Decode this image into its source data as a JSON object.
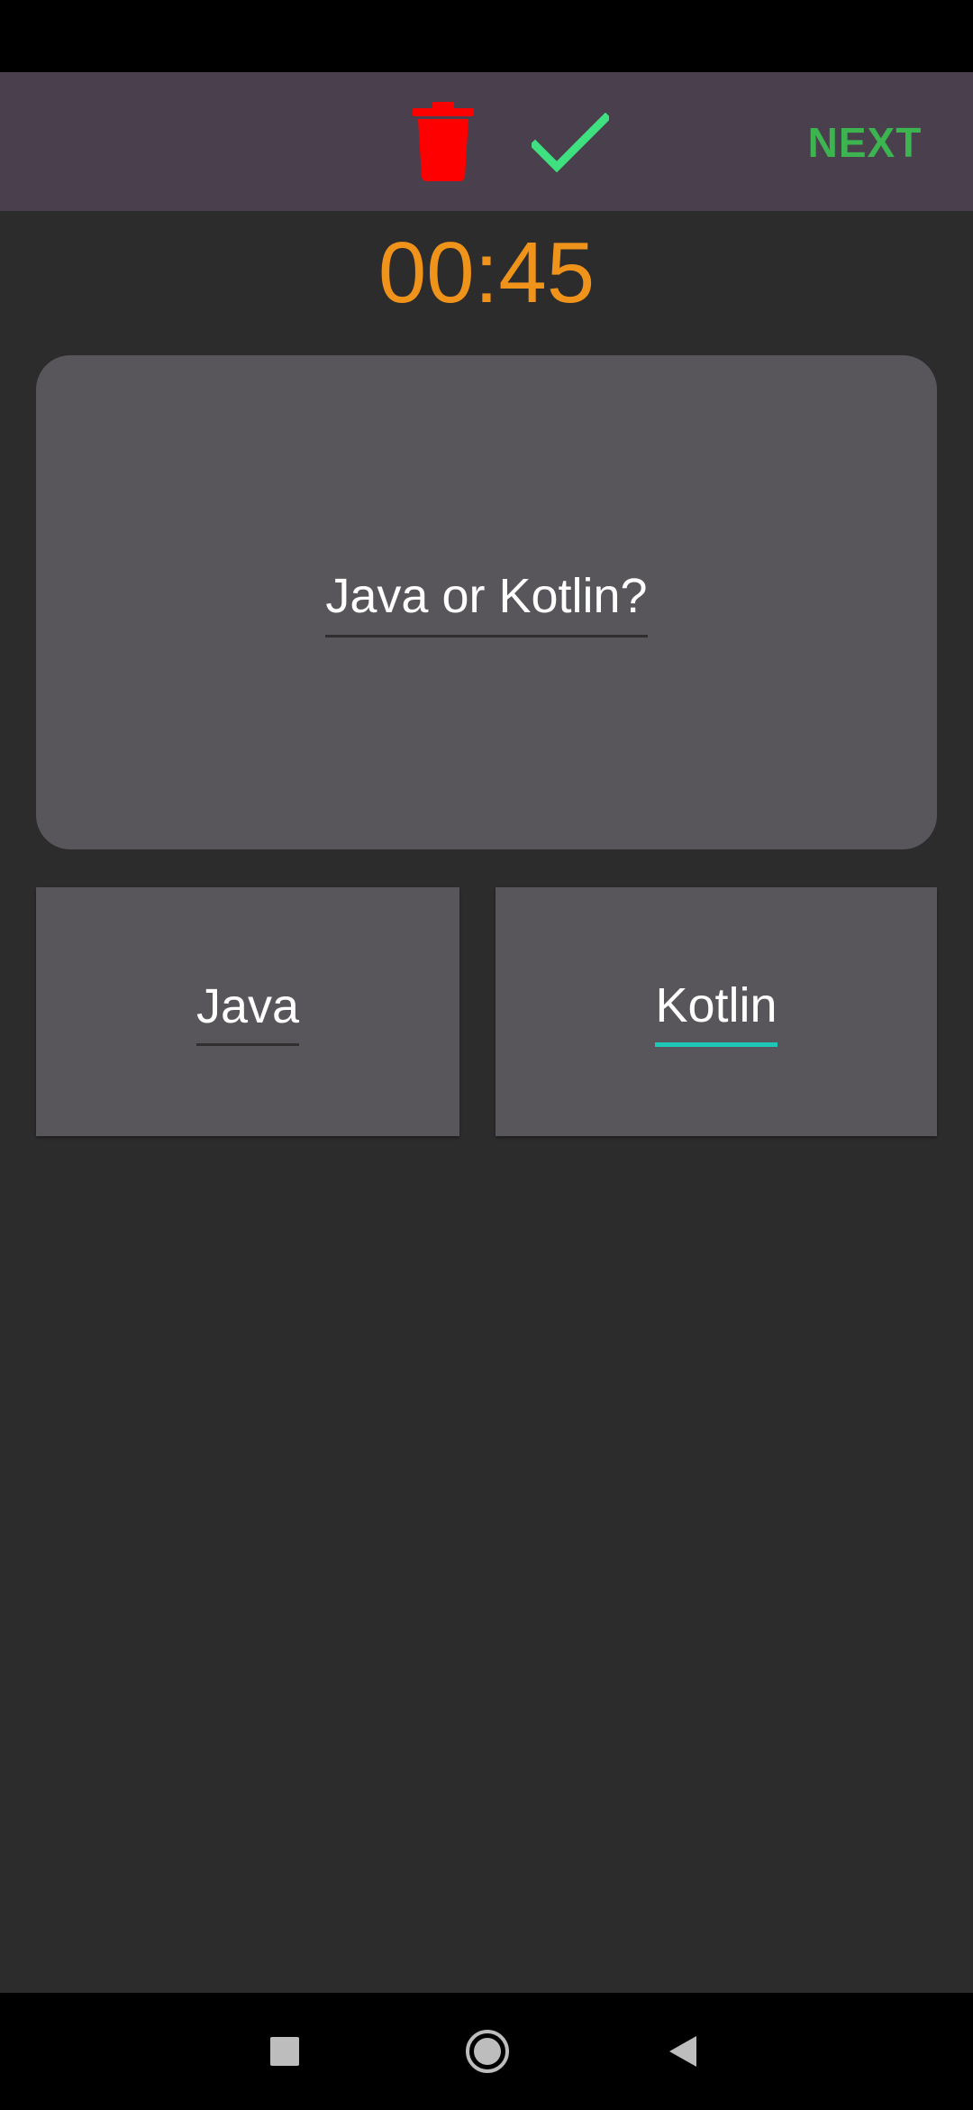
{
  "toolbar": {
    "delete_icon": "trash-icon",
    "confirm_icon": "check-icon",
    "next_label": "NEXT",
    "delete_color": "#ff0000",
    "confirm_color": "#3ee080",
    "next_color": "#3cb550"
  },
  "timer": {
    "value": "00:45",
    "color": "#f0931a"
  },
  "question": {
    "text": "Java or Kotlin?"
  },
  "answers": [
    {
      "label": "Java",
      "selected": false
    },
    {
      "label": "Kotlin",
      "selected": true,
      "accent": "#1fc7b7"
    }
  ],
  "nav": {
    "recents_icon": "square-icon",
    "home_icon": "home-circle-icon",
    "back_icon": "back-triangle-icon"
  }
}
